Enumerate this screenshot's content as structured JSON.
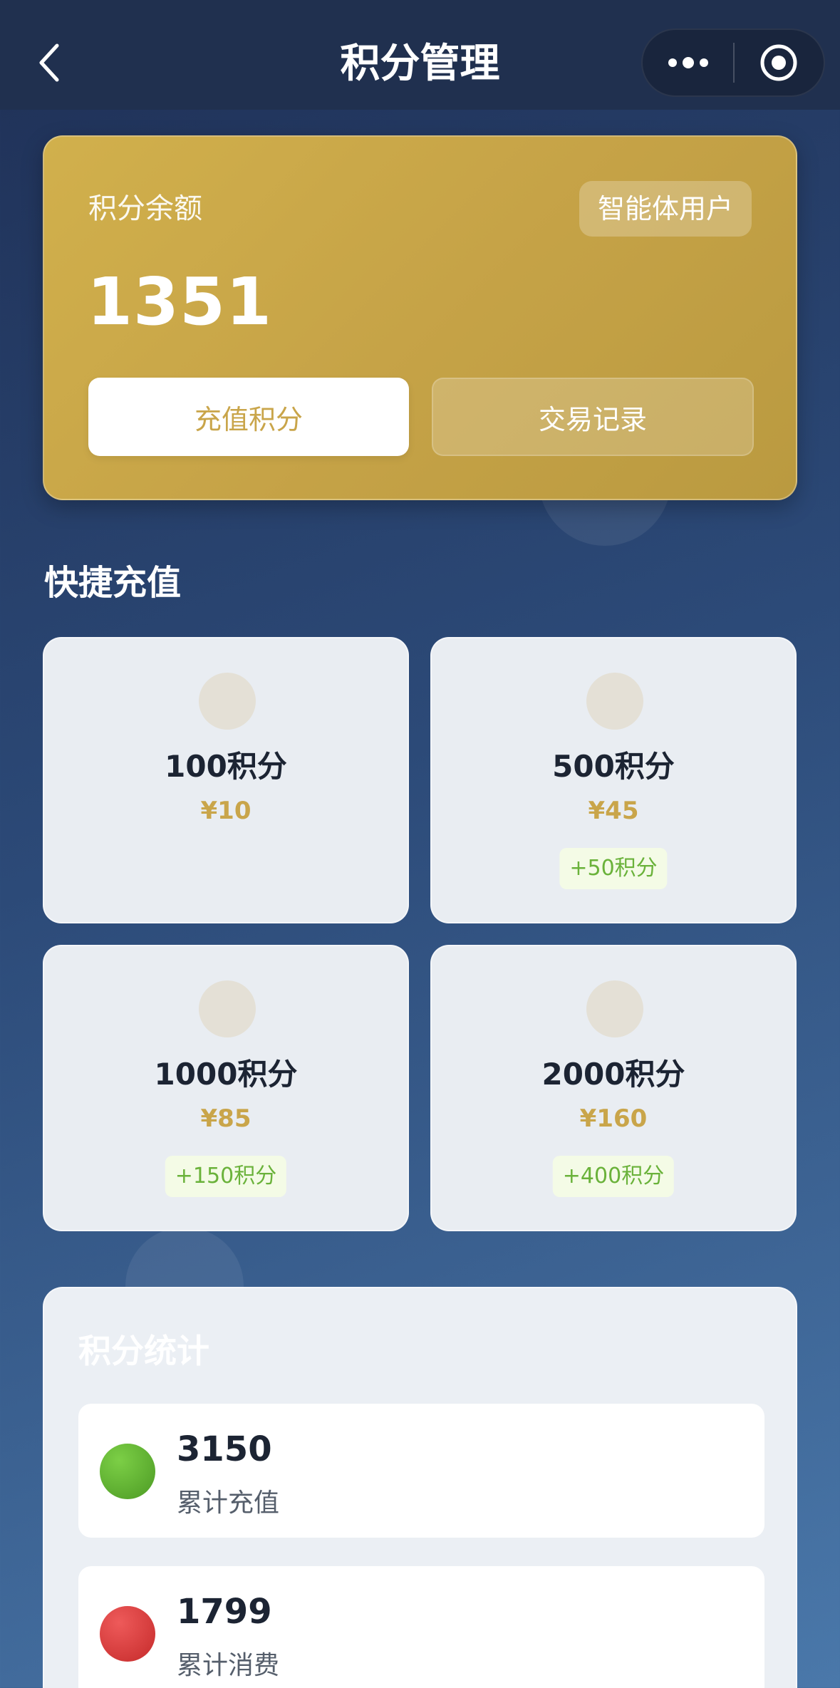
{
  "nav": {
    "title": "积分管理"
  },
  "balance_card": {
    "label": "积分余额",
    "user_type": "智能体用户",
    "balance": "1351",
    "recharge_button": "充值积分",
    "records_button": "交易记录"
  },
  "quick_recharge": {
    "title": "快捷充值",
    "packages": [
      {
        "points": "100积分",
        "price": "¥10",
        "bonus": ""
      },
      {
        "points": "500积分",
        "price": "¥45",
        "bonus": "+50积分"
      },
      {
        "points": "1000积分",
        "price": "¥85",
        "bonus": "+150积分"
      },
      {
        "points": "2000积分",
        "price": "¥160",
        "bonus": "+400积分"
      }
    ]
  },
  "stats": {
    "title": "积分统计",
    "items": [
      {
        "value": "3150",
        "label": "累计充值",
        "color": "#5aaa2e"
      },
      {
        "value": "1799",
        "label": "累计消费",
        "color": "#d63a3a"
      }
    ]
  },
  "colors": {
    "gold": "#c9a54a",
    "bonus_green": "#6ab23a",
    "nav_bg": "#20304f"
  }
}
